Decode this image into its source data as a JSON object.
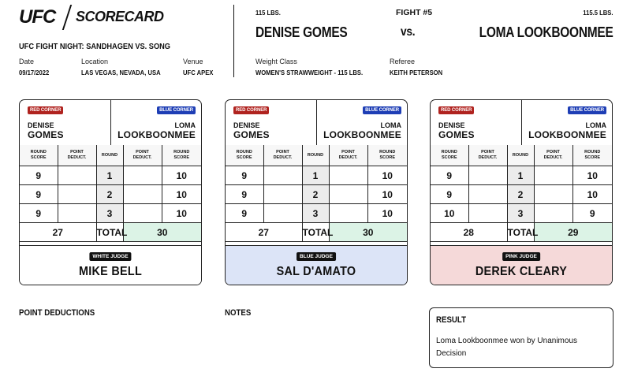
{
  "header": {
    "logo": "UFC",
    "title": "SCORECARD",
    "event": "UFC FIGHT NIGHT: SANDHAGEN VS. SONG",
    "date_label": "Date",
    "date": "09/17/2022",
    "location_label": "Location",
    "location": "LAS VEGAS, NEVADA, USA",
    "venue_label": "Venue",
    "venue": "UFC APEX"
  },
  "fight": {
    "red_weight": "115 LBS.",
    "fight_number": "FIGHT #5",
    "blue_weight": "115.5 LBS.",
    "red_name": "DENISE GOMES",
    "vs": "vs.",
    "blue_name": "LOMA LOOKBOONMEE",
    "weight_class_label": "Weight Class",
    "weight_class": "WOMEN'S STRAWWEIGHT - 115 LBS.",
    "referee_label": "Referee",
    "referee": "KEITH PETERSON"
  },
  "labels": {
    "red_corner": "RED CORNER",
    "blue_corner": "BLUE CORNER",
    "red_first": "DENISE",
    "red_last": "GOMES",
    "blue_first": "LOMA",
    "blue_last": "LOOKBOONMEE",
    "round_score": "ROUND SCORE",
    "point_deduct": "POINT DEDUCT.",
    "round": "ROUND",
    "total": "TOTAL"
  },
  "cards": [
    {
      "judge_label": "WHITE JUDGE",
      "judge_name": "MIKE BELL",
      "judge_bg": "#ffffff",
      "rounds": [
        {
          "round": "1",
          "red": "9",
          "blue": "10"
        },
        {
          "round": "2",
          "red": "9",
          "blue": "10"
        },
        {
          "round": "3",
          "red": "9",
          "blue": "10"
        }
      ],
      "red_total": "27",
      "blue_total": "30"
    },
    {
      "judge_label": "BLUE JUDGE",
      "judge_name": "SAL D'AMATO",
      "judge_bg": "#dce4f7",
      "rounds": [
        {
          "round": "1",
          "red": "9",
          "blue": "10"
        },
        {
          "round": "2",
          "red": "9",
          "blue": "10"
        },
        {
          "round": "3",
          "red": "9",
          "blue": "10"
        }
      ],
      "red_total": "27",
      "blue_total": "30"
    },
    {
      "judge_label": "PINK JUDGE",
      "judge_name": "DEREK CLEARY",
      "judge_bg": "#f5d9d9",
      "rounds": [
        {
          "round": "1",
          "red": "9",
          "blue": "10"
        },
        {
          "round": "2",
          "red": "9",
          "blue": "10"
        },
        {
          "round": "3",
          "red": "10",
          "blue": "9"
        }
      ],
      "red_total": "28",
      "blue_total": "29"
    }
  ],
  "sections": {
    "point_deductions": "POINT DEDUCTIONS",
    "notes": "NOTES",
    "result_title": "RESULT",
    "result_text": "Loma Lookboonmee won by Unanimous Decision"
  }
}
